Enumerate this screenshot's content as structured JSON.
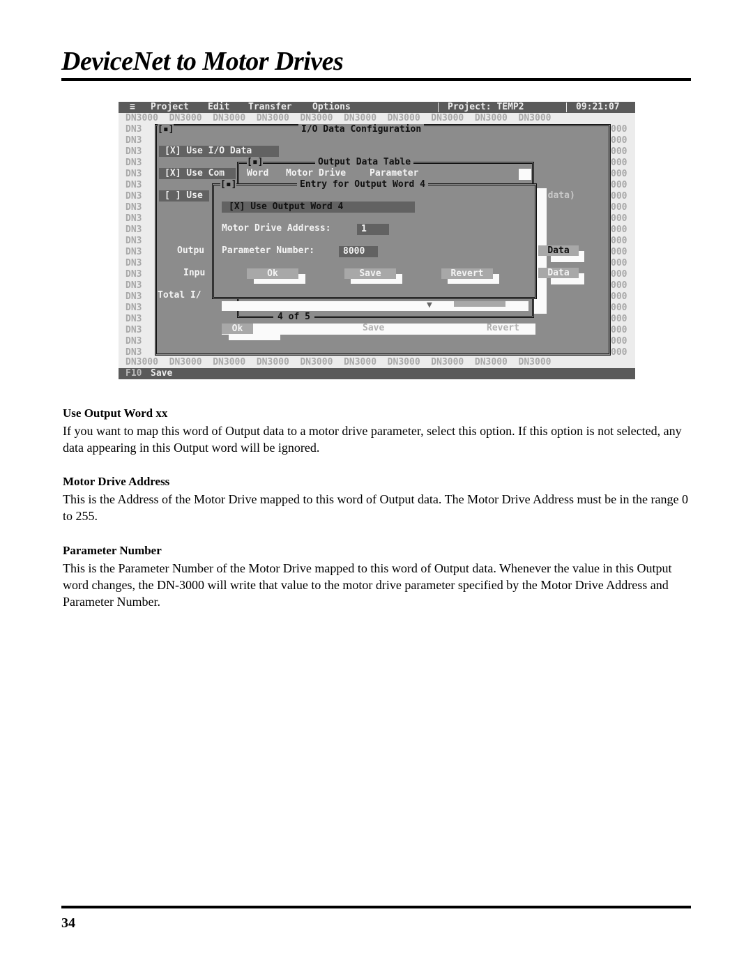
{
  "header": {
    "title": "DeviceNet to Motor Drives"
  },
  "terminal": {
    "menu": {
      "system_icon": "≡",
      "items": [
        "Project",
        "Edit",
        "Transfer",
        "Options"
      ],
      "project_label": "Project: TEMP2",
      "clock": "09:21:07"
    },
    "background_pattern": "DN3000",
    "io_config": {
      "close_box": "[▪]",
      "title": "I/O Data Configuration",
      "options": [
        "[X] Use I/O Data",
        "[X] Use Com",
        "[ ] Use"
      ],
      "labels": [
        "Outpu",
        "Inpu",
        "Total I/"
      ],
      "data_fragment": ") data)",
      "data_buttons": [
        "Data",
        "Data"
      ],
      "buttons": [
        "Ok",
        "Save",
        "Revert"
      ]
    },
    "output_table": {
      "close_box": "[▪]",
      "title": "Output Data Table",
      "columns": [
        "Word",
        "Motor Drive",
        "Parameter"
      ],
      "pager": "4 of 5",
      "scroll_icon": "▼"
    },
    "entry_dialog": {
      "close_box": "[▪]",
      "title": "Entry for Output Word 4",
      "use_checkbox": "[X] Use Output Word 4",
      "address_label": "Motor Drive Address:",
      "address_value": "1",
      "parameter_label": "Parameter Number:",
      "parameter_value": "8000",
      "buttons": {
        "ok": "Ok",
        "save": "Save",
        "revert": "Revert"
      }
    },
    "status": {
      "hotkey": "F10",
      "label": "Save"
    }
  },
  "sections": [
    {
      "heading": "Use Output Word xx",
      "body": "If you want to map this word of Output data to a motor drive parameter, select this option.  If this option is not selected, any data appearing in this Output word will be ignored."
    },
    {
      "heading": "Motor Drive Address",
      "body": "This is the Address of the Motor Drive mapped to this word of Output data.  The Motor Drive Address must be in the range 0 to 255."
    },
    {
      "heading": "Parameter Number",
      "body": "This is the Parameter Number of the Motor Drive mapped to this word of Output data.  Whenever the value in this Output word changes, the DN-3000 will write that value to the motor drive parameter specified by the Motor Drive Address and Parameter Number."
    }
  ],
  "footer": {
    "page_number": "34"
  }
}
